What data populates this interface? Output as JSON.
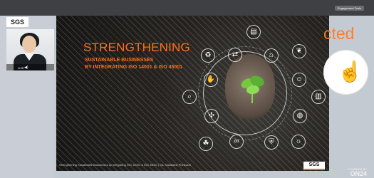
{
  "top": {
    "engage_label": "Engagement Tools"
  },
  "left": {
    "sgs_badge": "SGS",
    "live_label": "LIVE"
  },
  "slide": {
    "title": "STRENGTHENING",
    "subtitle_line1": "SUSTAINABLE BUSINESSES",
    "subtitle_line2": "BY INTEGRATING ISO 14001 & ISO 45001",
    "caption": "Strengthening Sustainable Businesses by Integrating ISO 14001 & ISO 45001 | Ms. Sasikarnk Phetsurat",
    "logo": "SGS"
  },
  "right": {
    "ghost_text": "cted"
  },
  "footer": {
    "brand_small": "POWERED BY",
    "brand": "ON24"
  }
}
